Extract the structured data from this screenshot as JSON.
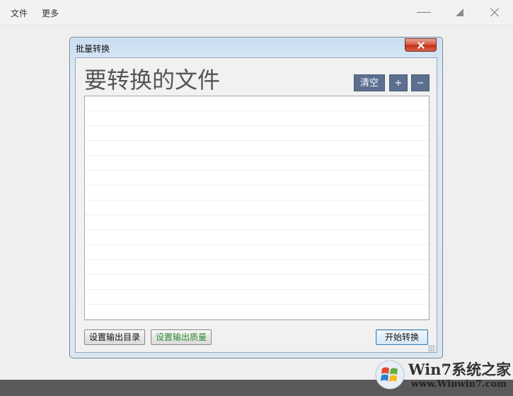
{
  "app": {
    "menu": [
      "文件",
      "更多"
    ]
  },
  "dialog": {
    "title": "批量转换",
    "heading": "要转换的文件",
    "buttons": {
      "clear": "清空",
      "add": "+",
      "remove": "−",
      "set_output_dir": "设置输出目录",
      "set_output_quality": "设置输出质量",
      "start": "开始转换"
    },
    "file_list": []
  },
  "watermark": {
    "brand": "Win7系统之家",
    "url": "www.Winwin7.com"
  },
  "colors": {
    "tool_button": "#5c6f8f",
    "quality_button_text": "#2f8a2f",
    "close_button": "#c2321a"
  }
}
